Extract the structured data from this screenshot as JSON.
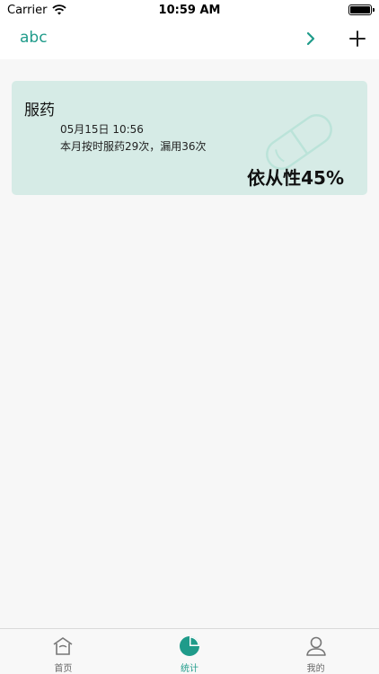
{
  "status_bar": {
    "carrier": "Carrier",
    "time": "10:59 AM"
  },
  "nav": {
    "title": "abc"
  },
  "card": {
    "title": "服药",
    "date": "05月15日 10:56",
    "summary": "本月按时服药29次，漏用36次",
    "compliance": "依从性45%"
  },
  "tabs": [
    {
      "label": "首页",
      "icon": "home-icon",
      "active": false
    },
    {
      "label": "统计",
      "icon": "pie-chart-icon",
      "active": true
    },
    {
      "label": "我的",
      "icon": "user-icon",
      "active": false
    }
  ],
  "colors": {
    "accent": "#1f9b8a",
    "card_bg": "#d6ebe6"
  }
}
